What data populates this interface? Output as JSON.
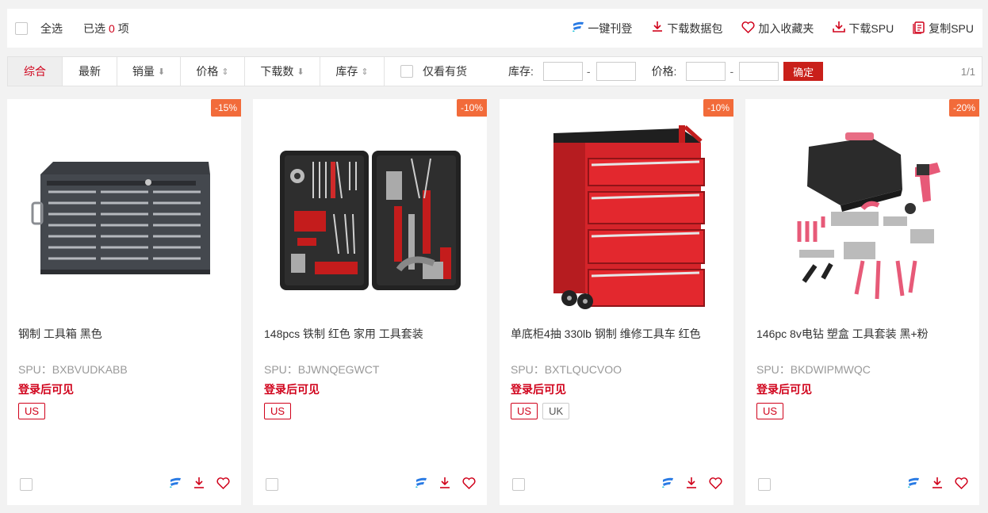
{
  "toolbar": {
    "select_all": "全选",
    "selected_prefix": "已选",
    "selected_count": "0",
    "selected_suffix": "项",
    "actions": [
      {
        "label": "一键刊登",
        "icon": "publish-icon"
      },
      {
        "label": "下载数据包",
        "icon": "download-icon"
      },
      {
        "label": "加入收藏夹",
        "icon": "heart-icon"
      },
      {
        "label": "下载SPU",
        "icon": "download-tray-icon"
      },
      {
        "label": "复制SPU",
        "icon": "copy-doc-icon"
      }
    ]
  },
  "filters": {
    "sorts": [
      {
        "label": "综合",
        "arrow": ""
      },
      {
        "label": "最新",
        "arrow": ""
      },
      {
        "label": "销量",
        "arrow": "⬇"
      },
      {
        "label": "价格",
        "arrow": "⇕"
      },
      {
        "label": "下载数",
        "arrow": "⬇"
      },
      {
        "label": "库存",
        "arrow": "⇕"
      }
    ],
    "in_stock_label": "仅看有货",
    "stock_label": "库存:",
    "price_label": "价格:",
    "dash": "-",
    "confirm_label": "确定",
    "page_indicator": "1/1"
  },
  "products": [
    {
      "discount": "-15%",
      "title": "钢制 工具箱 黑色",
      "spu": "SPU：BXBVUDKABB",
      "login_note": "登录后可见",
      "tags": [
        "US"
      ]
    },
    {
      "discount": "-10%",
      "title": "148pcs 铁制 红色 家用 工具套装",
      "spu": "SPU：BJWNQEGWCT",
      "login_note": "登录后可见",
      "tags": [
        "US"
      ]
    },
    {
      "discount": "-10%",
      "title": "单底柜4抽 330lb 钢制 维修工具车 红色",
      "spu": "SPU：BXTLQUCVOO",
      "login_note": "登录后可见",
      "tags": [
        "US",
        "UK"
      ]
    },
    {
      "discount": "-20%",
      "title": "146pc 8v电钻 塑盒 工具套装 黑+粉",
      "spu": "SPU：BKDWIPMWQC",
      "login_note": "登录后可见",
      "tags": [
        "US"
      ]
    }
  ],
  "colors": {
    "accent": "#d0021b",
    "badge": "#f26b3a",
    "confirm": "#c9201a"
  }
}
